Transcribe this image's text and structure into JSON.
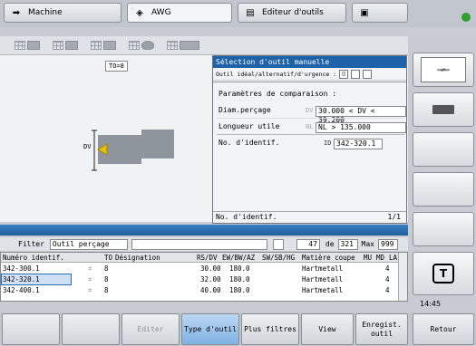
{
  "tabs": {
    "machine": "Machine",
    "avg": "AWG",
    "tool_editor": "Editeur d'outils"
  },
  "graphic": {
    "to_label": "TO=8",
    "dv_label": "DV"
  },
  "dialog": {
    "title": "Sélection d'outil manuelle",
    "ideal_label": "Outil idéal/alternatif/d'urgence :",
    "compare_heading": "Paramètres de comparaison :",
    "diam_label": "Diam.perçage",
    "diam_prefix": "DV",
    "diam_value": "30.000 < DV < 39.200",
    "length_label": "Longueur utile",
    "length_prefix": "NL",
    "length_value": "NL > 135.000",
    "ident_label": "No. d'identif.",
    "ident_prefix": "ID",
    "ident_value": "342-320.1",
    "footer_label": "No. d'identif.",
    "footer_page": "1/1"
  },
  "filter": {
    "label": "Filter",
    "value": "Outil perçage",
    "count": "47",
    "of_label": "de",
    "total": "321",
    "max_label": "Max",
    "max_value": "999"
  },
  "table": {
    "headers": [
      "Numéro identif. ▲",
      "TO",
      "Désignation",
      "RS/DV",
      "EW/BW/AZ",
      "SW/SB/HG",
      "Matière coupe",
      "MU",
      "MD",
      "LA"
    ],
    "rows": [
      {
        "id": "342-300.1",
        "to": "8",
        "rs": "30.00",
        "ew": "180.0",
        "mat": "Hartmetall",
        "md": "4"
      },
      {
        "id": "342-320.1",
        "to": "8",
        "rs": "32.00",
        "ew": "180.0",
        "mat": "Hartmetall",
        "md": "4"
      },
      {
        "id": "342-400.1",
        "to": "8",
        "rs": "40.00",
        "ew": "180.0",
        "mat": "Hartmetall",
        "md": "4"
      }
    ]
  },
  "clock": "14:45",
  "softkeys": {
    "edit": "Editer",
    "tool_type": "Type d'outil",
    "more_filters": "Plus filtres",
    "view": "View",
    "save_tool": "Enregist. outil",
    "back": "Retour"
  },
  "colors": {
    "accent": "#1e63a8",
    "selected_row": "#cfe0f4",
    "active_softkey": "#9dc4ec"
  }
}
